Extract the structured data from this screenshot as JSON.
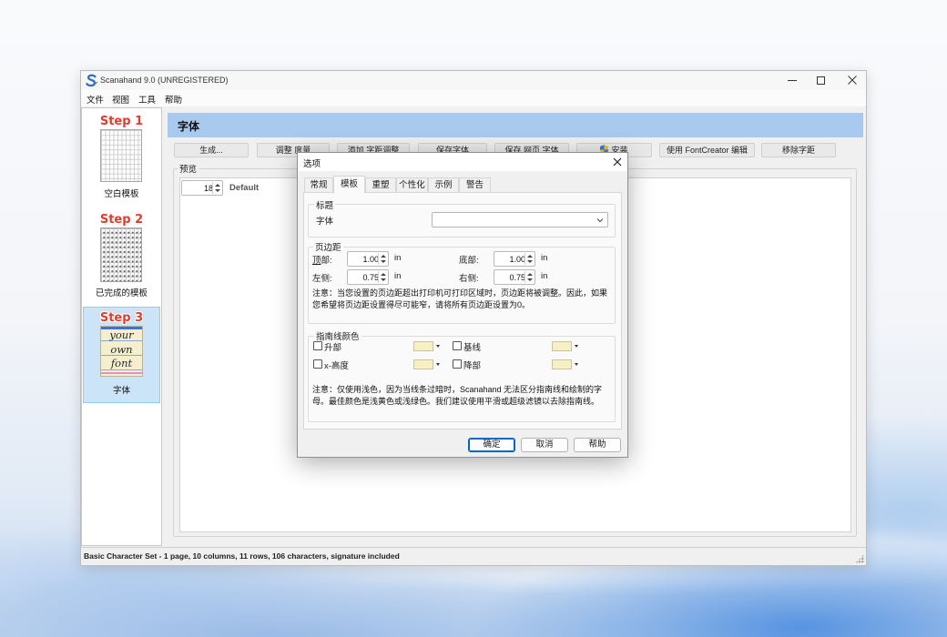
{
  "window": {
    "title": "Scanahand 9.0 (UNREGISTERED)"
  },
  "menu": {
    "items": [
      "文件",
      "视图",
      "工具",
      "帮助"
    ]
  },
  "sidebar": {
    "items": [
      {
        "step": "Step 1",
        "label": "空白模板"
      },
      {
        "step": "Step 2",
        "label": "已完成的模板"
      },
      {
        "step": "Step 3",
        "label": "字体",
        "sample": [
          "your",
          "own",
          "font"
        ]
      }
    ]
  },
  "main": {
    "header": "字体",
    "toolbar": [
      "生成...",
      "调整 度量",
      "添加 字距调整",
      "保存字体",
      "保存 网页 字体",
      "安装",
      "使用 FontCreator 编辑",
      "移除字距"
    ],
    "preview_label": "预览",
    "preview_size": "18",
    "preview_font": "Default"
  },
  "status": "Basic Character Set - 1 page, 10 columns, 11 rows, 106 characters, signature included",
  "dialog": {
    "title": "选项",
    "tabs": [
      "常规",
      "模板",
      "重塑",
      "个性化",
      "示例",
      "警告"
    ],
    "heading_group": {
      "legend": "标题",
      "font_label": "字体"
    },
    "margins": {
      "legend": "页边距",
      "unit": "in",
      "top_label": "顶部:",
      "top": "1.00",
      "bottom_label": "底部:",
      "bottom": "1.00",
      "left_label": "左侧:",
      "left": "0.75",
      "right_label": "右侧:",
      "right": "0.75",
      "note": "注意：当您设置的页边距超出打印机可打印区域时，页边距将被调整。因此，如果您希望将页边距设置得尽可能窄，请将所有页边距设置为0。"
    },
    "guides": {
      "legend": "指南线颜色",
      "items": [
        {
          "label": "升部",
          "checked": false,
          "color": "#f6f0c4"
        },
        {
          "label": "基线",
          "checked": false,
          "color": "#f6f0c4"
        },
        {
          "label": "x-高度",
          "checked": false,
          "color": "#f6f0c4"
        },
        {
          "label": "降部",
          "checked": false,
          "color": "#f6f0c4"
        }
      ],
      "note": "注意：仅使用浅色，因为当线条过暗时，Scanahand 无法区分指南线和绘制的字母。最佳颜色是浅黄色或浅绿色。我们建议使用平滑或超级滤镜以去除指南线。"
    },
    "buttons": {
      "ok": "确定",
      "cancel": "取消",
      "help": "帮助"
    }
  },
  "colors": {
    "header_bg": "#a8caef",
    "selection_bg": "#cce4f7",
    "selection_border": "#9bc9ee",
    "step_red": "#e5392a",
    "accent": "#0067c0"
  }
}
